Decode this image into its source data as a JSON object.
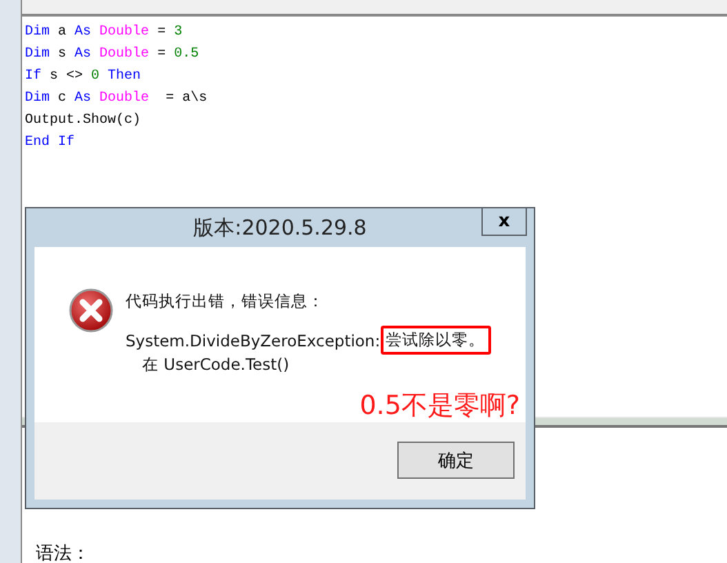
{
  "editor": {
    "lines": [
      [
        {
          "text": "Dim",
          "kind": "keyword"
        },
        {
          "text": " a ",
          "kind": "plain"
        },
        {
          "text": "As",
          "kind": "keyword"
        },
        {
          "text": " Double",
          "kind": "type"
        },
        {
          "text": " = ",
          "kind": "plain"
        },
        {
          "text": "3",
          "kind": "number"
        }
      ],
      [
        {
          "text": "Dim",
          "kind": "keyword"
        },
        {
          "text": " s ",
          "kind": "plain"
        },
        {
          "text": "As",
          "kind": "keyword"
        },
        {
          "text": " Double",
          "kind": "type"
        },
        {
          "text": " = ",
          "kind": "plain"
        },
        {
          "text": "0.5",
          "kind": "number"
        }
      ],
      [
        {
          "text": "If",
          "kind": "keyword"
        },
        {
          "text": " s <> ",
          "kind": "plain"
        },
        {
          "text": "0",
          "kind": "number"
        },
        {
          "text": " Then",
          "kind": "keyword"
        }
      ],
      [
        {
          "text": "Dim",
          "kind": "keyword"
        },
        {
          "text": " c ",
          "kind": "plain"
        },
        {
          "text": "As",
          "kind": "keyword"
        },
        {
          "text": " Double",
          "kind": "type"
        },
        {
          "text": "  = a\\s",
          "kind": "plain"
        }
      ],
      [
        {
          "text": "Output.Show(c)",
          "kind": "plain"
        }
      ],
      [
        {
          "text": "End If",
          "kind": "keyword"
        }
      ]
    ]
  },
  "help": {
    "syntax_label": "语法："
  },
  "dialog": {
    "title": "版本:2020.5.29.8",
    "close": "x",
    "message": "代码执行出错，错误信息：",
    "exception": "System.DivideByZeroException:",
    "highlighted": "尝试除以零。",
    "stack": "在 UserCode.Test()",
    "ok": "确定"
  },
  "annotation": "0.5不是零啊?"
}
